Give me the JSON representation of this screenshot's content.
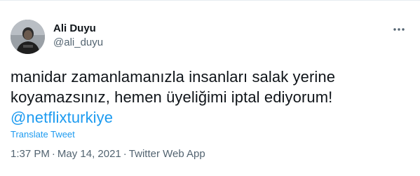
{
  "author": {
    "display_name": "Ali Duyu",
    "handle": "@ali_duyu"
  },
  "tweet": {
    "text_line1": "manidar zamanlamanızla insanları salak yerine",
    "text_line2": "koyamazsınız, hemen üyeliğimi iptal ediyorum!",
    "mention": "@netflixturkiye",
    "translate_label": "Translate Tweet"
  },
  "meta": {
    "time": "1:37 PM",
    "separator": "·",
    "date": "May 14, 2021",
    "source": "Twitter Web App"
  },
  "icons": {
    "more": "more-horizontal-icon"
  },
  "colors": {
    "link": "#1d9bf0",
    "text": "#0f1419",
    "secondary": "#536471"
  }
}
